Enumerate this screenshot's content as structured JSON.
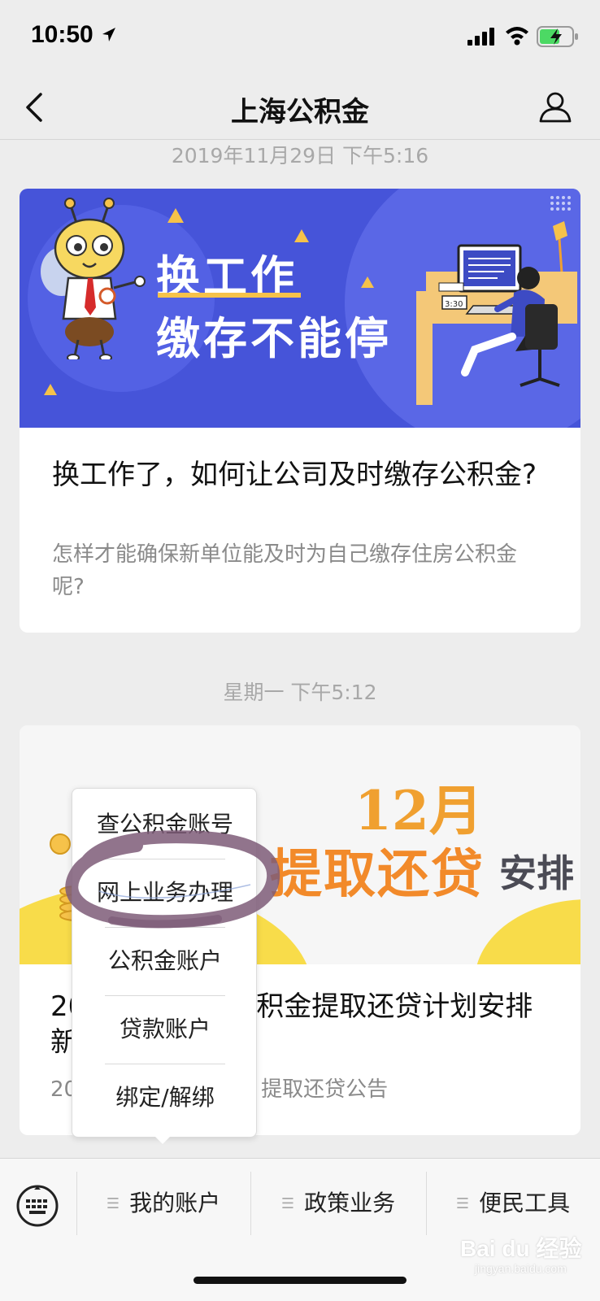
{
  "status_bar": {
    "time": "10:50"
  },
  "nav": {
    "title": "上海公积金"
  },
  "messages": [
    {
      "timestamp": "2019年11月29日 下午5:16",
      "banner_line1": "换工作",
      "banner_line2": "缴存不能停",
      "banner_clock": "3:30",
      "title": "换工作了，如何让公司及时缴存公积金?",
      "desc": "怎样才能确保新单位能及时为自己缴存住房公积金呢?"
    },
    {
      "timestamp": "星期一 下午5:12",
      "banner_month": "12月",
      "banner_main": "提取还贷",
      "banner_sub": "安排",
      "title_visible_left": "20",
      "title_visible_right": "积金提取还贷计划安排",
      "title_line2_visible": "新",
      "desc_visible_left": "20",
      "desc_visible_right": "提取还贷公告"
    }
  ],
  "popup_menu": {
    "items": [
      "查公积金账号",
      "网上业务办理",
      "公积金账户",
      "贷款账户",
      "绑定/解绑"
    ],
    "circled_item": "网上业务办理"
  },
  "bottom_menu": {
    "items": [
      "我的账户",
      "政策业务",
      "便民工具"
    ]
  },
  "watermark": {
    "brand": "Bai du 经验",
    "url": "jingyan.baidu.com"
  },
  "colors": {
    "banner1_bg": "#4654d9",
    "banner2_accent": "#f28a2a",
    "highlight_ring": "#7e5c78"
  }
}
